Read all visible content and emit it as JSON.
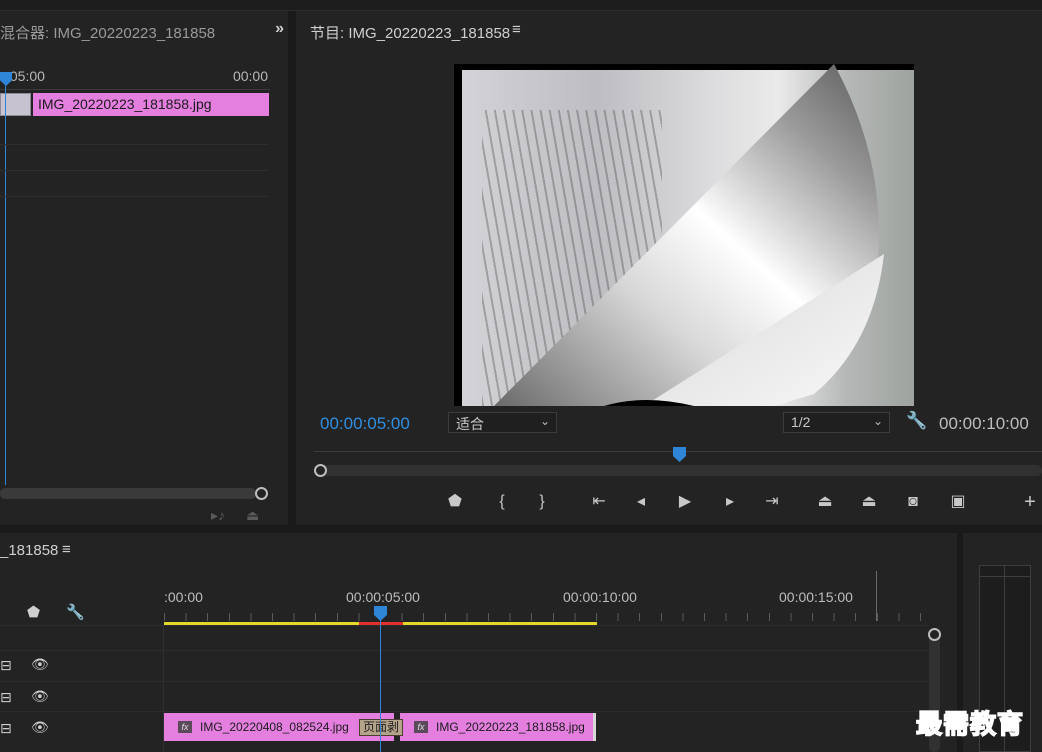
{
  "source_panel": {
    "title": "混合器: IMG_20220223_181858",
    "overflow_icon": "double-chevron-right-icon",
    "time_left": ":05:00",
    "time_right": "00:00",
    "clip_name": "IMG_20220223_181858.jpg"
  },
  "program_panel": {
    "title": "节目: IMG_20220223_181858",
    "menu_icon": "hamburger-icon",
    "timecode_current": "00:00:05:00",
    "fit_select": "适合",
    "resolution_select": "1/2",
    "timecode_duration": "00:00:10:00",
    "controls": [
      {
        "name": "add-marker-icon",
        "glyph": "⬟"
      },
      {
        "name": "mark-in-icon",
        "glyph": "{"
      },
      {
        "name": "mark-out-icon",
        "glyph": "}"
      },
      {
        "name": "go-to-in-icon",
        "glyph": "⇤"
      },
      {
        "name": "step-back-icon",
        "glyph": "◀"
      },
      {
        "name": "play-icon",
        "glyph": "▶"
      },
      {
        "name": "step-forward-icon",
        "glyph": "▶"
      },
      {
        "name": "go-to-out-icon",
        "glyph": "⇥"
      },
      {
        "name": "lift-icon",
        "glyph": "⏏"
      },
      {
        "name": "extract-icon",
        "glyph": "⏏"
      },
      {
        "name": "export-frame-icon",
        "glyph": "📷"
      },
      {
        "name": "compare-icon",
        "glyph": "▣"
      },
      {
        "name": "add-button-icon",
        "glyph": "+"
      }
    ]
  },
  "timeline_panel": {
    "title": "_181858",
    "ruler_labels": [
      ":00:00",
      "00:00:05:00",
      "00:00:10:00",
      "00:00:15:00"
    ],
    "clips": [
      {
        "name": "IMG_20220408_082524.jpg"
      },
      {
        "name": "IMG_20220223_181858.jpg"
      }
    ],
    "transition_label": "页面剥"
  },
  "watermark": "最需教育"
}
